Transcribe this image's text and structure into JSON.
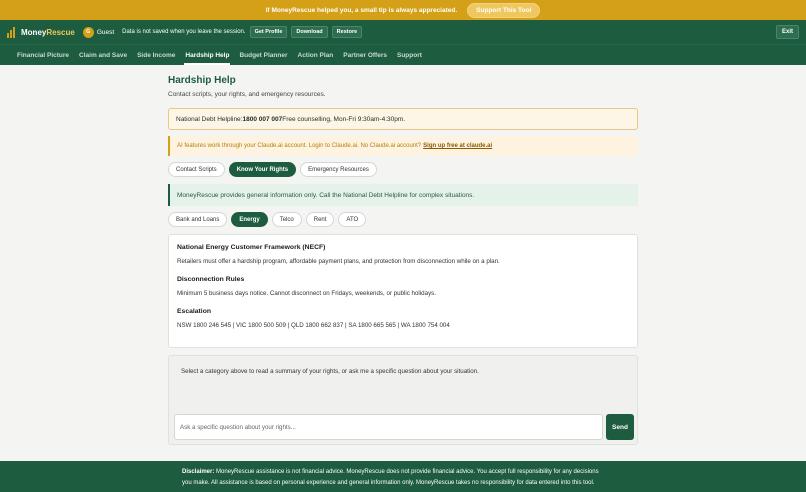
{
  "promo": {
    "text": "If MoneyRescue helped you, a small tip is always appreciated.",
    "button": "Support This Tool"
  },
  "header": {
    "brand_money": "Money",
    "brand_rescue": "Rescue",
    "avatar_letter": "G",
    "user": "Guest",
    "notice": "Data is not saved when you leave the session.",
    "buttons": [
      "Get Profile",
      "Download",
      "Restore"
    ],
    "exit": "Exit"
  },
  "nav": [
    "Financial Picture",
    "Claim and Save",
    "Side Income",
    "Hardship Help",
    "Budget Planner",
    "Action Plan",
    "Partner Offers",
    "Support"
  ],
  "page": {
    "title": "Hardship Help",
    "subtitle": "Contact scripts, your rights, and emergency resources."
  },
  "helpline": {
    "prefix": "National Debt Helpline: ",
    "number": "1800 007 007",
    "suffix": " Free counselling, Mon-Fri 9:30am-4:30pm."
  },
  "ai_note": {
    "text": "AI features work through your Claude.ai account. Login to Claude.ai. No Claude.ai account?",
    "link": "Sign up free at claude.ai"
  },
  "section_tabs": [
    "Contact Scripts",
    "Know Your Rights",
    "Emergency Resources"
  ],
  "info": "MoneyRescue provides general information only. Call the National Debt Helpline for complex situations.",
  "category_tabs": [
    "Bank and Loans",
    "Energy",
    "Telco",
    "Rent",
    "ATO"
  ],
  "rights": {
    "h1": "National Energy Customer Framework (NECF)",
    "p1": "Retailers must offer a hardship program, affordable payment plans, and protection from disconnection while on a plan.",
    "h2": "Disconnection Rules",
    "p2": "Minimum 5 business days notice. Cannot disconnect on Fridays, weekends, or public holidays.",
    "h3": "Escalation",
    "p3": "NSW 1800 246 545  |  VIC 1800 500 509  |  QLD 1800 662 837  |  SA 1800 665 565  |  WA 1800 754 004"
  },
  "chat": {
    "hint": "Select a category above to read a summary of your rights, or ask me a specific question about your situation.",
    "placeholder": "Ask a specific question about your rights...",
    "send": "Send"
  },
  "footer": {
    "label": "Disclaimer:",
    "line1": " MoneyRescue assistance is not financial advice. MoneyRescue does not provide financial advice. You accept full responsibility for any decisions",
    "line2": "you make. All assistance is based on personal experience and general information only. MoneyRescue takes no responsibility for data entered into this tool."
  },
  "colors": {
    "primary": "#1d5c3f",
    "accent": "#d4a017"
  }
}
